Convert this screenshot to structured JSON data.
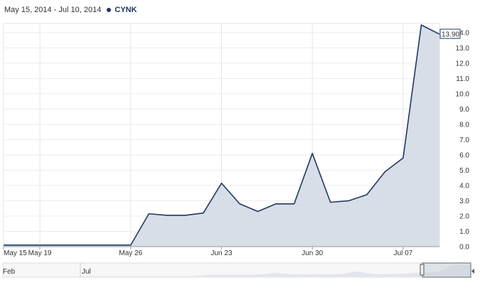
{
  "header": {
    "date_range": "May 15, 2014 - Jul 10, 2014",
    "ticker": "CYNK",
    "series_color": "#1f3864"
  },
  "navigator": {
    "labels": [
      "Feb",
      "Jul"
    ]
  },
  "chart_data": {
    "type": "area",
    "title": "",
    "xlabel": "",
    "ylabel": "",
    "ylim": [
      0,
      14.6
    ],
    "yticks": [
      "0.0",
      "1.0",
      "2.0",
      "3.0",
      "4.0",
      "5.0",
      "6.0",
      "7.0",
      "8.0",
      "9.0",
      "10.0",
      "11.0",
      "12.0",
      "13.0",
      "14.0"
    ],
    "x_tick_labels": [
      {
        "index": 0,
        "label": "May 15"
      },
      {
        "index": 2,
        "label": "May 19"
      },
      {
        "index": 7,
        "label": "May 26"
      },
      {
        "index": 12,
        "label": "Jun 23"
      },
      {
        "index": 17,
        "label": "Jun 30"
      },
      {
        "index": 22,
        "label": "Jul 07"
      }
    ],
    "grid": true,
    "series": [
      {
        "name": "CYNK",
        "color": "#1f3864",
        "fill": "#d4dae4",
        "x": [
          "May 15",
          "May 16",
          "May 19",
          "May 20",
          "May 21",
          "May 22",
          "May 23",
          "May 26",
          "Jun 18",
          "Jun 19",
          "Jun 20",
          "Jun 23",
          "Jun 24",
          "Jun 25",
          "Jun 26",
          "Jun 27",
          "Jun 30",
          "Jul 01",
          "Jul 02",
          "Jul 03",
          "Jul 04",
          "Jul 07",
          "Jul 08",
          "Jul 09",
          "Jul 10"
        ],
        "values": [
          0.1,
          0.1,
          0.1,
          0.1,
          0.1,
          0.1,
          0.1,
          0.1,
          2.15,
          2.05,
          2.05,
          2.2,
          4.15,
          2.8,
          2.3,
          2.8,
          2.8,
          6.1,
          2.9,
          3.0,
          3.4,
          4.9,
          5.8,
          14.5,
          13.9
        ]
      }
    ],
    "last_value_label": "13.90"
  }
}
